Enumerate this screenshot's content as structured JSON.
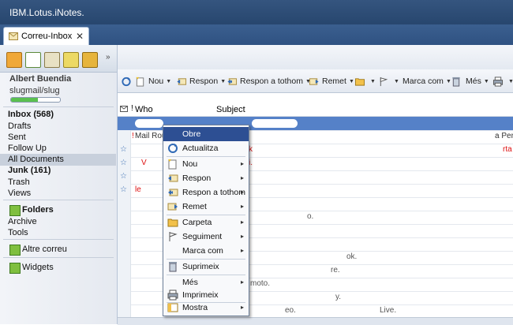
{
  "app": {
    "brand": "IBM.Lotus.iNotes."
  },
  "tab": {
    "label": "Correu-Inbox",
    "close": "✕"
  },
  "user": {
    "name": "Albert Buendia",
    "id": "slugmail/slug",
    "quota_fraction": 0.55
  },
  "nav": {
    "items": [
      "Inbox (568)",
      "Drafts",
      "Sent",
      "Follow Up",
      "All Documents",
      "Junk (161)",
      "Trash",
      "Views"
    ],
    "folders_label": "Folders",
    "folders_items": [
      "Archive",
      "Tools"
    ],
    "other_mail": "Altre correu",
    "widgets": "Widgets"
  },
  "toolbar": {
    "nou": "Nou",
    "respon": "Respon",
    "respon_tothom": "Respon a tothom",
    "remet": "Remet",
    "marca_com": "Marca com",
    "mes": "Més"
  },
  "list": {
    "col_who": "Who",
    "col_subject": "Subject",
    "mail_router": "Mail Rou",
    "a_per": "a Per",
    "frag_rta": "rta",
    "frag_k": "k",
    "frag_v": "V",
    "frag_i": "i.",
    "frag_le": "le",
    "frag_o": "o.",
    "frag_ok": "ok.",
    "frag_re": "re.",
    "frag_moto": "moto.",
    "frag_y": "y.",
    "frag_eo": "eo.",
    "frag_live": "Live."
  },
  "context_menu": {
    "items": [
      "Obre",
      "Actualitza",
      "Nou",
      "Respon",
      "Respon a tothom",
      "Remet",
      "Carpeta",
      "Seguiment",
      "Marca com",
      "Suprimeix",
      "Més",
      "Imprimeix",
      "Mostra"
    ]
  },
  "colors": {
    "title_bar": "#2b4a73",
    "selection": "#5581c8",
    "menu_highlight": "#2d4f93",
    "red_text": "#dd1111"
  }
}
